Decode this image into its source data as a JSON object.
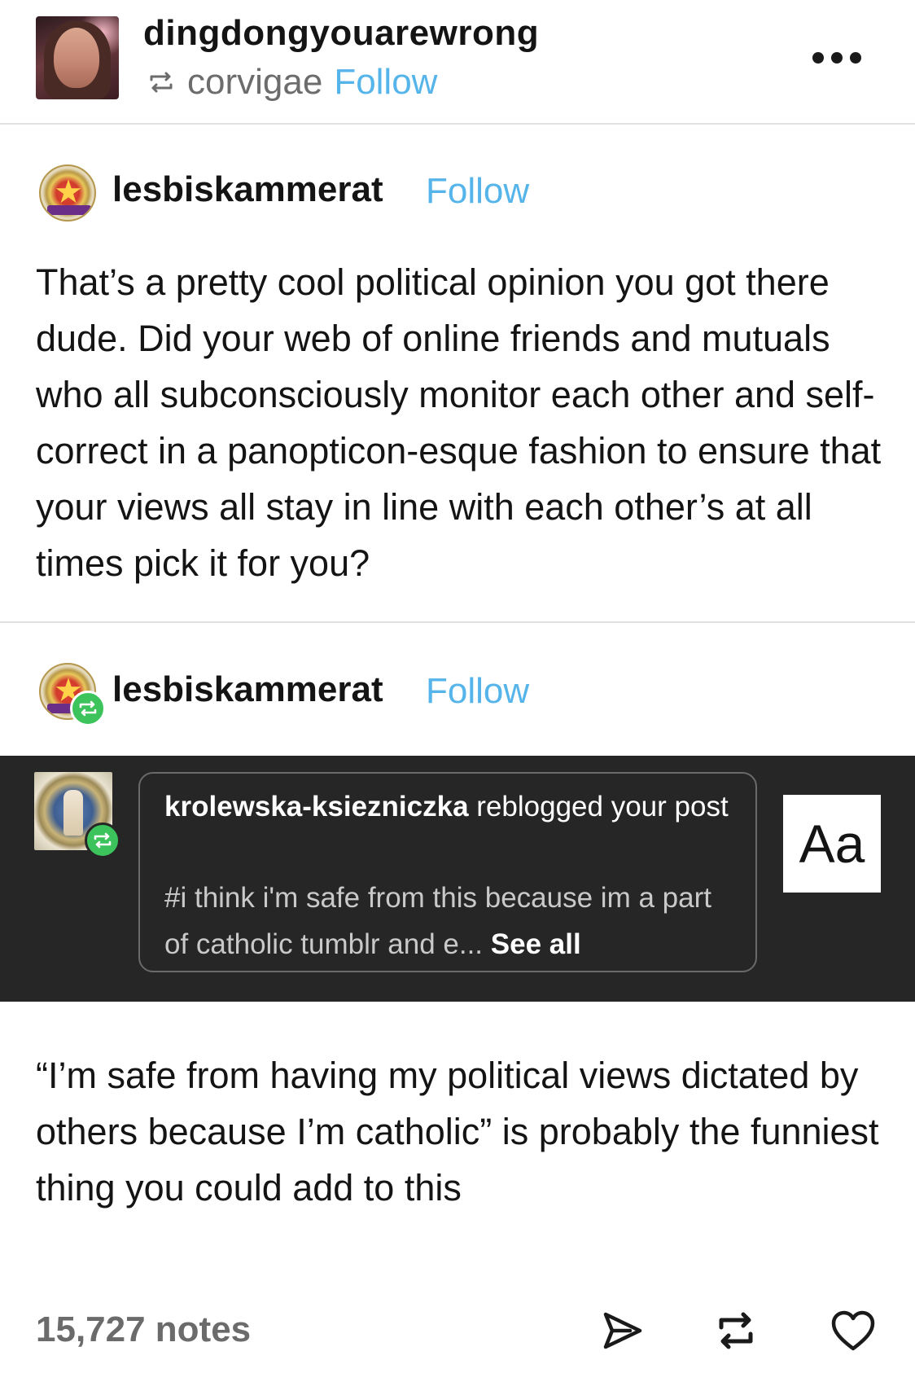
{
  "header": {
    "blog_name": "dingdongyouarewrong",
    "reblogged_from": "corvigae",
    "follow_label": "Follow",
    "more_icon": "more-horizontal-icon"
  },
  "posts": [
    {
      "username": "lesbiskammerat",
      "follow_label": "Follow",
      "text": "That’s a pretty cool political opinion you got there dude. Did your web of online friends and mutuals who all subconsciously monitor each other and self-correct in a panopticon-esque fashion to ensure that your views all stay in line with each other’s at all times pick it for you?"
    },
    {
      "username": "lesbiskammerat",
      "follow_label": "Follow",
      "screenshot": {
        "notification_user": "krolewska-ksiezniczka",
        "notification_action": " reblogged your post",
        "tags": "#i think i'm safe from this because im a part of catholic tumblr and e... ",
        "see_all": "See all",
        "aa_label": "Aa"
      },
      "text": "“I’m safe from having my political views dictated by others because I’m catholic” is probably the funniest thing you could add to this"
    }
  ],
  "footer": {
    "notes": "15,727 notes",
    "share_icon": "send-icon",
    "reblog_icon": "reblog-icon",
    "like_icon": "heart-icon"
  },
  "colors": {
    "follow": "#55b4ea",
    "reblog_badge": "#3cc35c",
    "dark_panel": "#262626"
  }
}
